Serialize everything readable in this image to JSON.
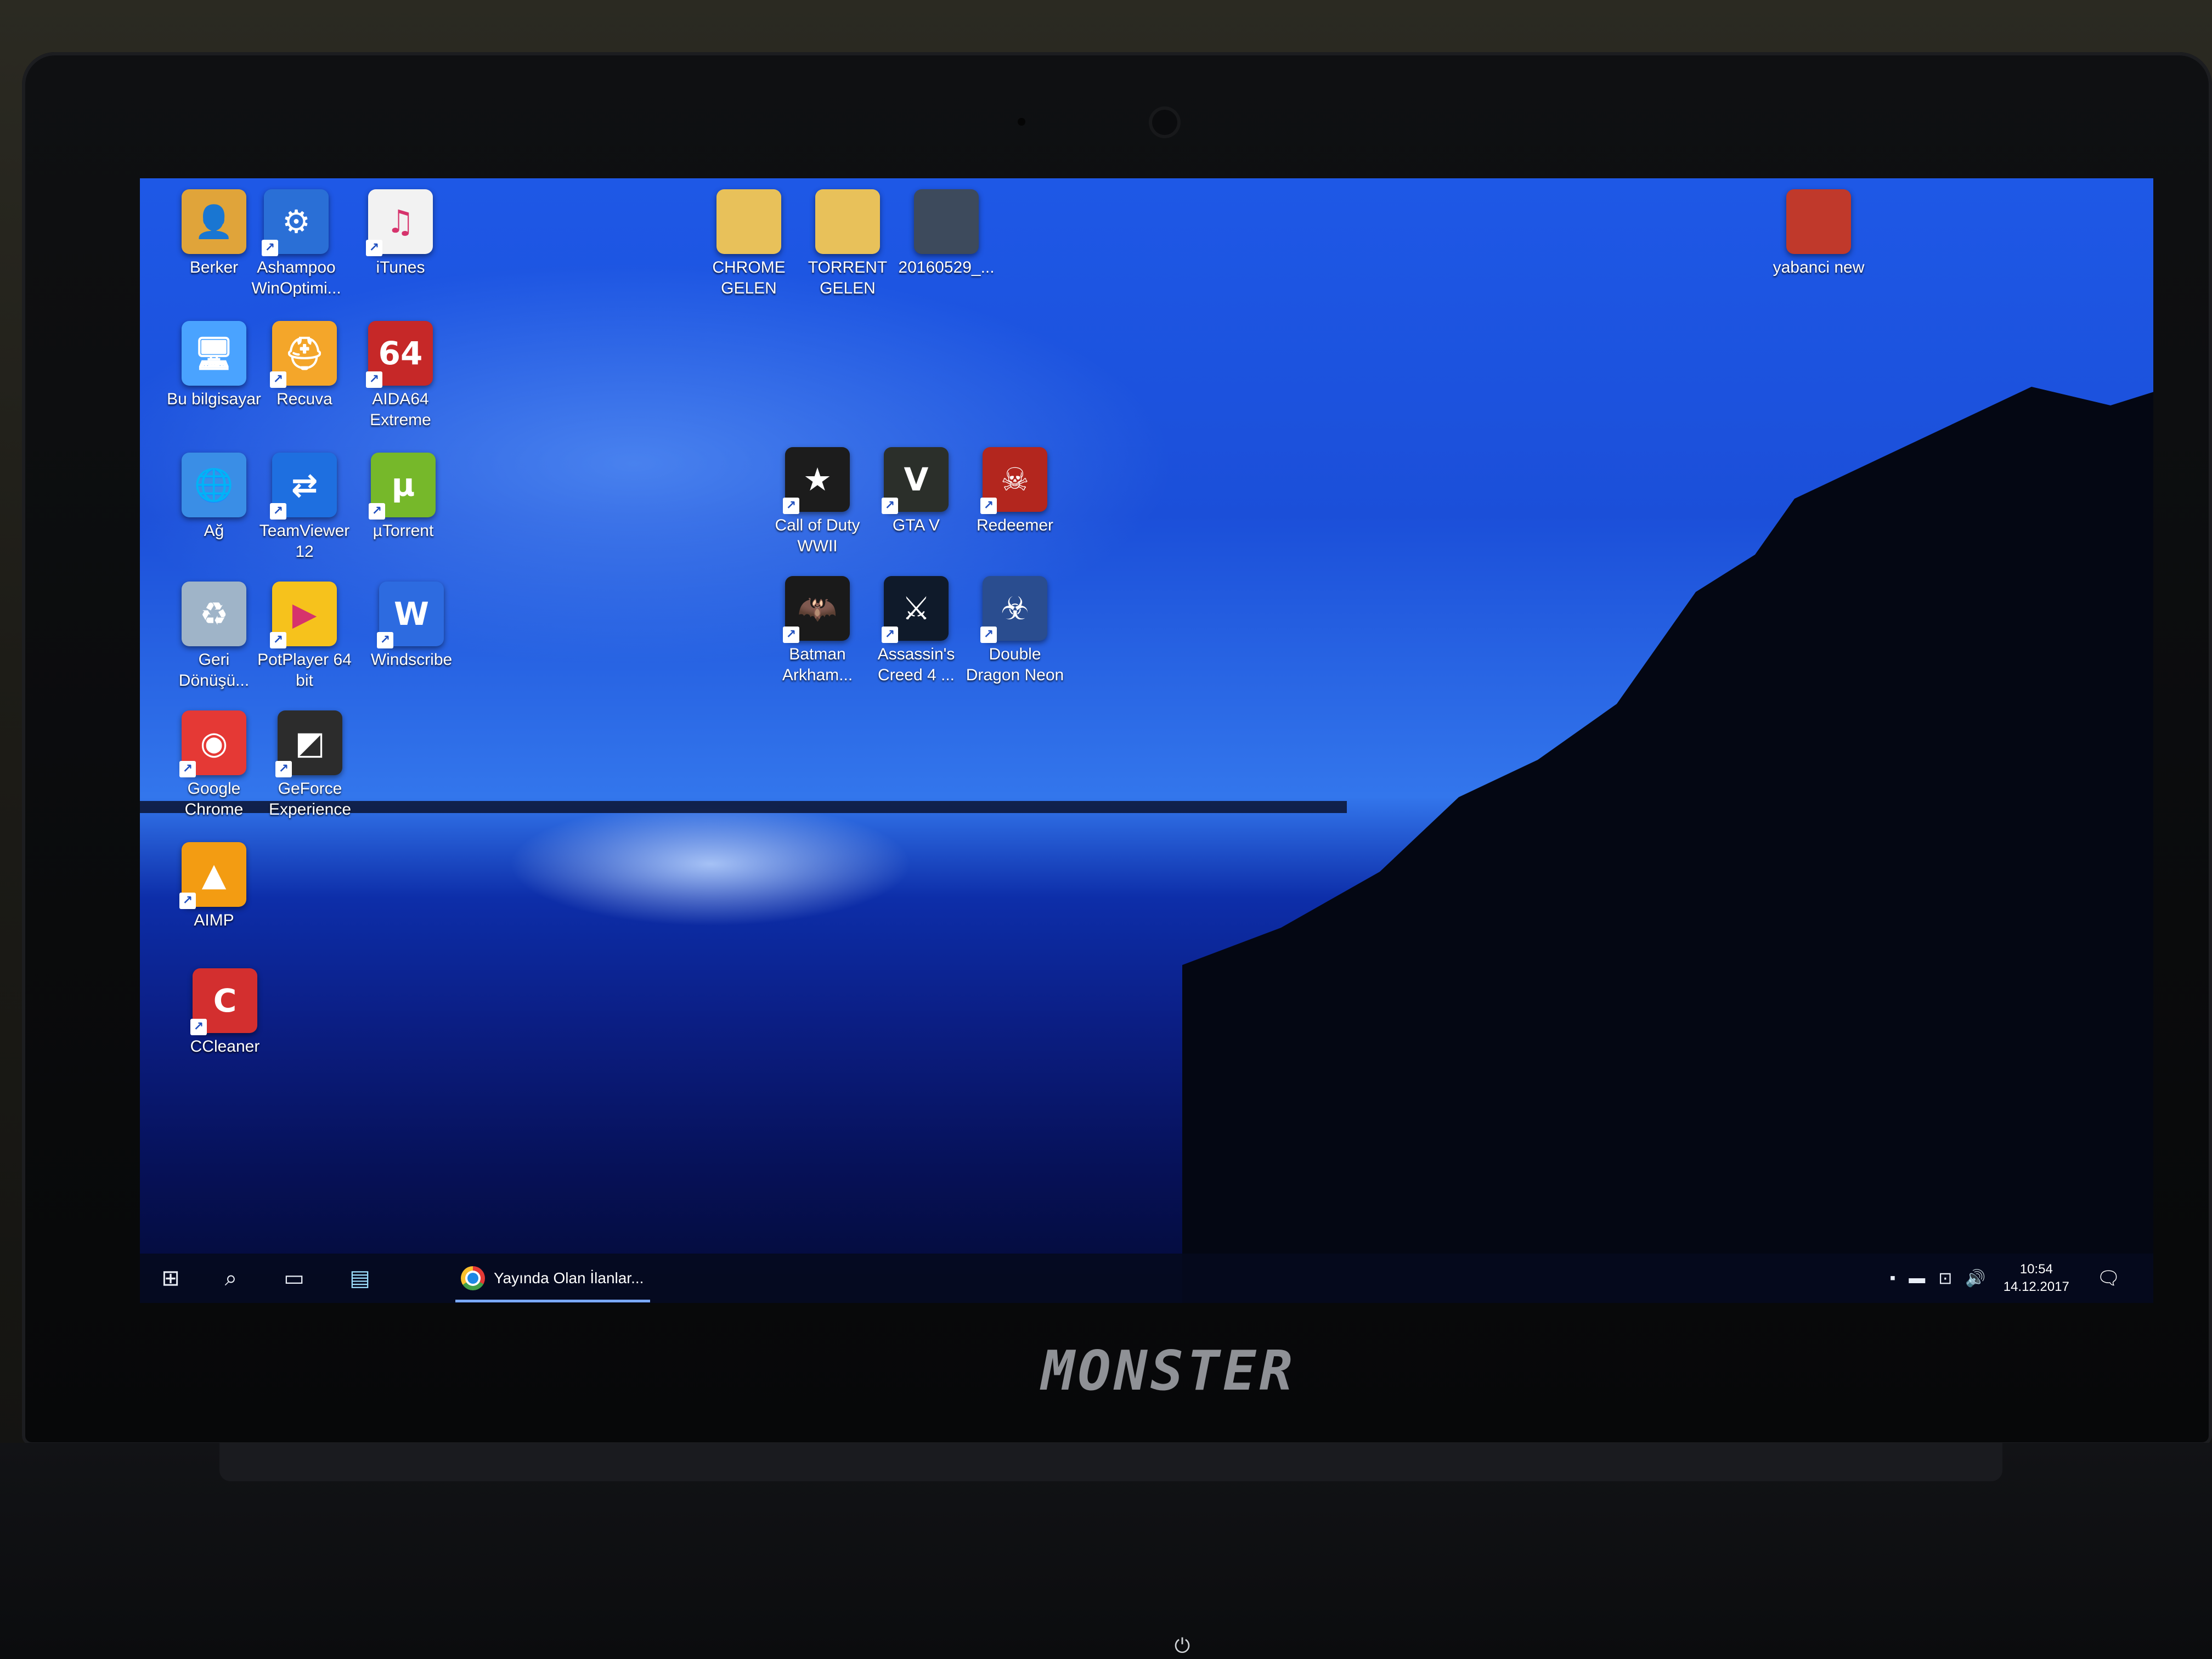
{
  "desktop_icons": [
    {
      "label": "Berker",
      "icon": "user-folder-icon",
      "color": "#e0a43a",
      "glyph": "👤",
      "shortcut": false
    },
    {
      "label": "Ashampoo WinOptimi...",
      "icon": "gear-icon",
      "color": "#2a6fd6",
      "glyph": "⚙",
      "shortcut": true
    },
    {
      "label": "iTunes",
      "icon": "music-note-icon",
      "color": "#f2f2f2",
      "glyph": "♫",
      "shortcut": true
    },
    {
      "label": "CHROME GELEN",
      "icon": "folder-icon",
      "color": "#e8c15a",
      "glyph": "",
      "shortcut": false
    },
    {
      "label": "TORRENT GELEN",
      "icon": "folder-icon",
      "color": "#e8c15a",
      "glyph": "",
      "shortcut": false
    },
    {
      "label": "20160529_...",
      "icon": "photo-icon",
      "color": "#3d4a5c",
      "glyph": "",
      "shortcut": false
    },
    {
      "label": "yabanci new",
      "icon": "folder-icon",
      "color": "#c0392b",
      "glyph": "",
      "shortcut": false
    },
    {
      "label": "Bu bilgisayar",
      "icon": "computer-icon",
      "color": "#4aa3ff",
      "glyph": "🖥",
      "shortcut": false
    },
    {
      "label": "Recuva",
      "icon": "recuva-icon",
      "color": "#f4a62a",
      "glyph": "⛑",
      "shortcut": true
    },
    {
      "label": "AIDA64 Extreme",
      "icon": "aida64-icon",
      "color": "#c62828",
      "glyph": "64",
      "shortcut": true
    },
    {
      "label": "Ağ",
      "icon": "network-icon",
      "color": "#3a8ee6",
      "glyph": "🌐",
      "shortcut": false
    },
    {
      "label": "TeamViewer 12",
      "icon": "teamviewer-icon",
      "color": "#1e6fe0",
      "glyph": "⇄",
      "shortcut": true
    },
    {
      "label": "µTorrent",
      "icon": "utorrent-icon",
      "color": "#76b82a",
      "glyph": "µ",
      "shortcut": true
    },
    {
      "label": "Call of Duty WWII",
      "icon": "star-emblem-icon",
      "color": "#1c1c1c",
      "glyph": "★",
      "shortcut": true
    },
    {
      "label": "GTA V",
      "icon": "gta-icon",
      "color": "#2b2f2a",
      "glyph": "V",
      "shortcut": true
    },
    {
      "label": "Redeemer",
      "icon": "redeemer-icon",
      "color": "#b3261e",
      "glyph": "☠",
      "shortcut": true
    },
    {
      "label": "Geri Dönüşü...",
      "icon": "recycle-bin-icon",
      "color": "#9fb4c8",
      "glyph": "♻",
      "shortcut": false
    },
    {
      "label": "PotPlayer 64 bit",
      "icon": "potplayer-icon",
      "color": "#f6c21c",
      "glyph": "▶",
      "shortcut": true
    },
    {
      "label": "Windscribe",
      "icon": "windscribe-icon",
      "color": "#2d6be0",
      "glyph": "W",
      "shortcut": true
    },
    {
      "label": "Batman Arkham...",
      "icon": "batman-icon",
      "color": "#1a1a1a",
      "glyph": "🦇",
      "shortcut": true
    },
    {
      "label": "Assassin's Creed 4 ...",
      "icon": "assassins-creed-icon",
      "color": "#0f1a2a",
      "glyph": "⚔",
      "shortcut": true
    },
    {
      "label": "Double Dragon Neon",
      "icon": "double-dragon-icon",
      "color": "#2a4d8f",
      "glyph": "☣",
      "shortcut": true
    },
    {
      "label": "Google Chrome",
      "icon": "chrome-icon",
      "color": "#e53935",
      "glyph": "◉",
      "shortcut": true
    },
    {
      "label": "GeForce Experience",
      "icon": "geforce-icon",
      "color": "#2c2c2c",
      "glyph": "◩",
      "shortcut": true
    },
    {
      "label": "AIMP",
      "icon": "aimp-icon",
      "color": "#f39c12",
      "glyph": "▲",
      "shortcut": true
    },
    {
      "label": "CCleaner",
      "icon": "ccleaner-icon",
      "color": "#d32f2f",
      "glyph": "C",
      "shortcut": true
    }
  ],
  "taskbar": {
    "start_icon": "windows-logo-icon",
    "search_icon": "search-icon",
    "task_view_icon": "task-view-icon",
    "explorer_icon": "file-explorer-icon",
    "active_app_label": "Yayında Olan İlanlar...",
    "clock_time": "10:54",
    "clock_date": "14.12.2017"
  },
  "brand": "MONSTER"
}
